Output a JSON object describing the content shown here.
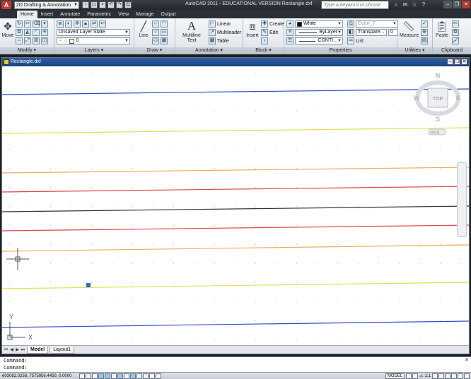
{
  "titlebar": {
    "workspace": "2D Drafting & Annotation",
    "title": "AutoCAD 2011 - EDUCATIONAL VERSION   Rectangle.dxf",
    "search_placeholder": "Type a keyword or phrase"
  },
  "tabs": [
    {
      "label": "Home",
      "active": true
    },
    {
      "label": "Insert"
    },
    {
      "label": "Annotate"
    },
    {
      "label": "Parametric"
    },
    {
      "label": "View"
    },
    {
      "label": "Manage"
    },
    {
      "label": "Output"
    }
  ],
  "ribbon": {
    "modify": {
      "title": "Modify ▾",
      "move": "Move"
    },
    "layers": {
      "title": "Layers ▾",
      "layer_state": "Unsaved Layer State",
      "current_layer": "0"
    },
    "draw": {
      "title": "Draw ▾",
      "line": "Line"
    },
    "annotation": {
      "title": "Annotation ▾",
      "multiline_text": "Multiline Text",
      "linear": "Linear",
      "multileader": "Multileader",
      "table": "Table"
    },
    "block": {
      "title": "Block ▾",
      "insert": "Insert",
      "create": "Create",
      "edit": "Edit"
    },
    "properties": {
      "title": "Properties",
      "color": "White",
      "linetype_value": "ByLayer",
      "lineweight_value": "CONTI...",
      "plot_style": "Color_7",
      "transparency": "Transpare...",
      "transparency_value": "0",
      "list": "List"
    },
    "utilities": {
      "title": "Utilities ▾",
      "measure": "Measure"
    },
    "clipboard": {
      "title": "Clipboard",
      "paste": "Paste"
    }
  },
  "document": {
    "title": "Rectangle.dxf",
    "layout_tabs": [
      {
        "label": "Model",
        "active": true
      },
      {
        "label": "Layout1"
      }
    ]
  },
  "viewcube": {
    "north": "N",
    "south": "S",
    "east": "E",
    "west": "W",
    "top": "TOP",
    "wcs": "WCS"
  },
  "ucs": {
    "x": "X",
    "y": "Y"
  },
  "command_line": {
    "line1": "Command:",
    "line2": "Command:"
  },
  "statusbar": {
    "coordinates": "603082.0258, 7575956.4450, 0.0000",
    "model": "MODEL",
    "annotation_scale": "1:1"
  },
  "colors": {
    "blue_line": "#3548c9",
    "yellow_line": "#e6df4a",
    "orange_line": "#ecae58",
    "red_line": "#e0454a",
    "black_line": "#333333",
    "grip": "#1e6fd0"
  }
}
